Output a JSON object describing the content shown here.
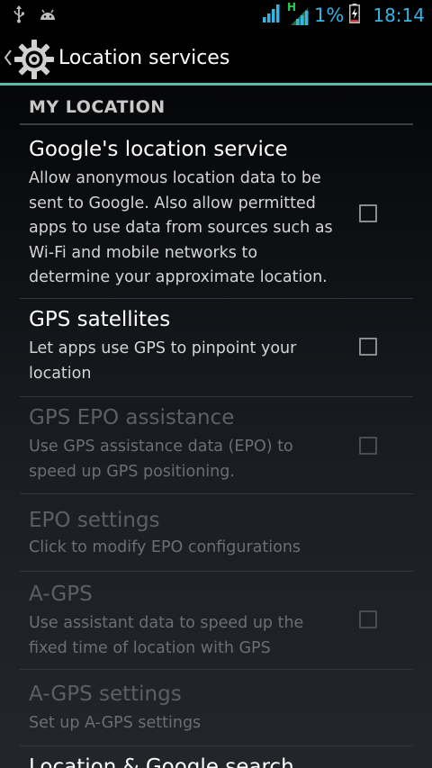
{
  "status_bar": {
    "battery_percent": "1%",
    "clock": "18:14",
    "icons": [
      "usb-icon",
      "android-icon",
      "signal-icon",
      "data-signal-icon",
      "battery-charging-icon"
    ],
    "data_type": "H",
    "accent_color": "#33b5e5"
  },
  "action_bar": {
    "title": "Location services",
    "icon": "settings-gear-icon",
    "underline_color": "#5fb8a8"
  },
  "section": {
    "header": "MY LOCATION"
  },
  "preferences": [
    {
      "title": "Google's location service",
      "summary": "Allow anonymous location data to be sent to Google. Also allow permitted apps to use data from sources such as Wi-Fi and mobile networks to determine your approximate location.",
      "checked": false,
      "enabled": true
    },
    {
      "title": "GPS satellites",
      "summary": "Let apps use GPS to pinpoint your location",
      "checked": false,
      "enabled": true
    },
    {
      "title": "GPS EPO assistance",
      "summary": "Use GPS assistance data (EPO) to speed up GPS positioning.",
      "checked": false,
      "enabled": false
    },
    {
      "title": "EPO settings",
      "summary": "Click to modify EPO configurations",
      "enabled": false
    },
    {
      "title": "A-GPS",
      "summary": "Use assistant data to speed up the fixed time of location with GPS",
      "checked": false,
      "enabled": false
    },
    {
      "title": "A-GPS settings",
      "summary": "Set up A-GPS settings",
      "enabled": false
    },
    {
      "title": "Location & Google search",
      "enabled": true
    }
  ]
}
